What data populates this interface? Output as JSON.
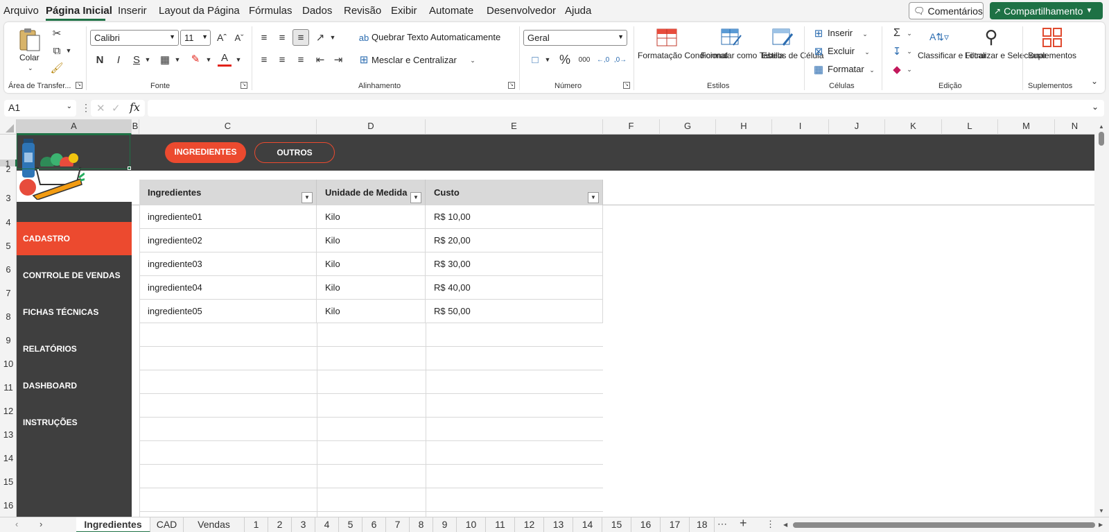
{
  "menu": {
    "items": [
      "Arquivo",
      "Página Inicial",
      "Inserir",
      "Layout da Página",
      "Fórmulas",
      "Dados",
      "Revisão",
      "Exibir",
      "Automate",
      "Desenvolvedor",
      "Ajuda"
    ],
    "comments": "Comentários",
    "share": "Compartilhamento"
  },
  "ribbon": {
    "clipboard": {
      "paste": "Colar",
      "label": "Área de Transfer..."
    },
    "font": {
      "name": "Calibri",
      "size": "11",
      "bold": "N",
      "italic": "I",
      "underline": "S",
      "label": "Fonte"
    },
    "alignment": {
      "wrap": "Quebrar Texto Automaticamente",
      "merge": "Mesclar e Centralizar",
      "label": "Alinhamento"
    },
    "number": {
      "format": "Geral",
      "percent": "%",
      "thousands": "000",
      "label": "Número"
    },
    "styles": {
      "conditional": "Formatação Condicional",
      "table": "Formatar como Tabela",
      "cell": "Estilos de Célula",
      "label": "Estilos"
    },
    "cells": {
      "insert": "Inserir",
      "delete": "Excluir",
      "format": "Formatar",
      "label": "Células"
    },
    "editing": {
      "sort": "Classificar e Filtrar",
      "find": "Localizar e Selecionar",
      "label": "Edição"
    },
    "addins": {
      "button": "Suplementos",
      "label": "Suplementos"
    }
  },
  "formula_bar": {
    "name_box": "A1",
    "fx": "fx",
    "value": ""
  },
  "columns": [
    "A",
    "B",
    "C",
    "D",
    "E",
    "F",
    "G",
    "H",
    "I",
    "J",
    "K",
    "L",
    "M",
    "N"
  ],
  "rows": [
    "1",
    "2",
    "3",
    "4",
    "5",
    "6",
    "7",
    "8",
    "9",
    "10",
    "11",
    "12",
    "13",
    "14",
    "15",
    "16"
  ],
  "sheet": {
    "pills": {
      "ingredientes": "INGREDIENTES",
      "outros": "OUTROS"
    },
    "nav": [
      "CADASTRO",
      "CONTROLE DE VENDAS",
      "FICHAS TÉCNICAS",
      "RELATÓRIOS",
      "DASHBOARD",
      "INSTRUÇÕES"
    ],
    "table": {
      "headers": [
        "Ingredientes",
        "Unidade de Medida",
        "Custo"
      ],
      "rows": [
        [
          "ingrediente01",
          "Kilo",
          "R$ 10,00"
        ],
        [
          "ingrediente02",
          "Kilo",
          "R$ 20,00"
        ],
        [
          "ingrediente03",
          "Kilo",
          "R$ 30,00"
        ],
        [
          "ingrediente04",
          "Kilo",
          "R$ 40,00"
        ],
        [
          "ingrediente05",
          "Kilo",
          "R$ 50,00"
        ]
      ]
    }
  },
  "tabs": [
    "Ingredientes",
    "CAD",
    "Vendas",
    "1",
    "2",
    "3",
    "4",
    "5",
    "6",
    "7",
    "8",
    "9",
    "10",
    "11",
    "12",
    "13",
    "14",
    "15",
    "16",
    "17",
    "18"
  ],
  "colors": {
    "accent": "#ec4a2f",
    "dark": "#3f3f3f",
    "excel_green": "#1e7145"
  }
}
